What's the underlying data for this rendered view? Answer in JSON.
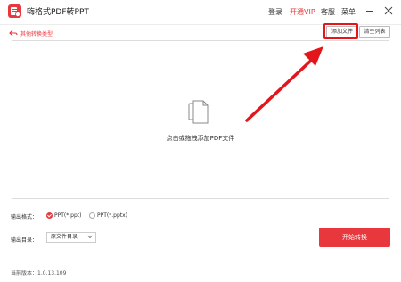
{
  "app": {
    "title": "嗨格式PDF转PPT",
    "accent": "#e8383d",
    "highlight": "#e3161c"
  },
  "header": {
    "login": "登录",
    "vip": "开通VIP",
    "service": "客服",
    "menu": "菜单"
  },
  "subbar": {
    "back_text": "其他转换类型",
    "add_file": "添加文件",
    "clear_list": "清空列表"
  },
  "dropzone": {
    "hint": "点击或拖拽添加PDF文件",
    "icon": "documents-icon"
  },
  "options": {
    "format_label": "输出格式：",
    "formats": [
      {
        "label": "PPT(*.ppt)",
        "selected": true
      },
      {
        "label": "PPT(*.pptx)",
        "selected": false
      }
    ],
    "dir_label": "输出目录：",
    "dir_value": "原文件目录"
  },
  "start_button": "开始转换",
  "footer": {
    "version": "当前版本：1.0.13.109"
  }
}
